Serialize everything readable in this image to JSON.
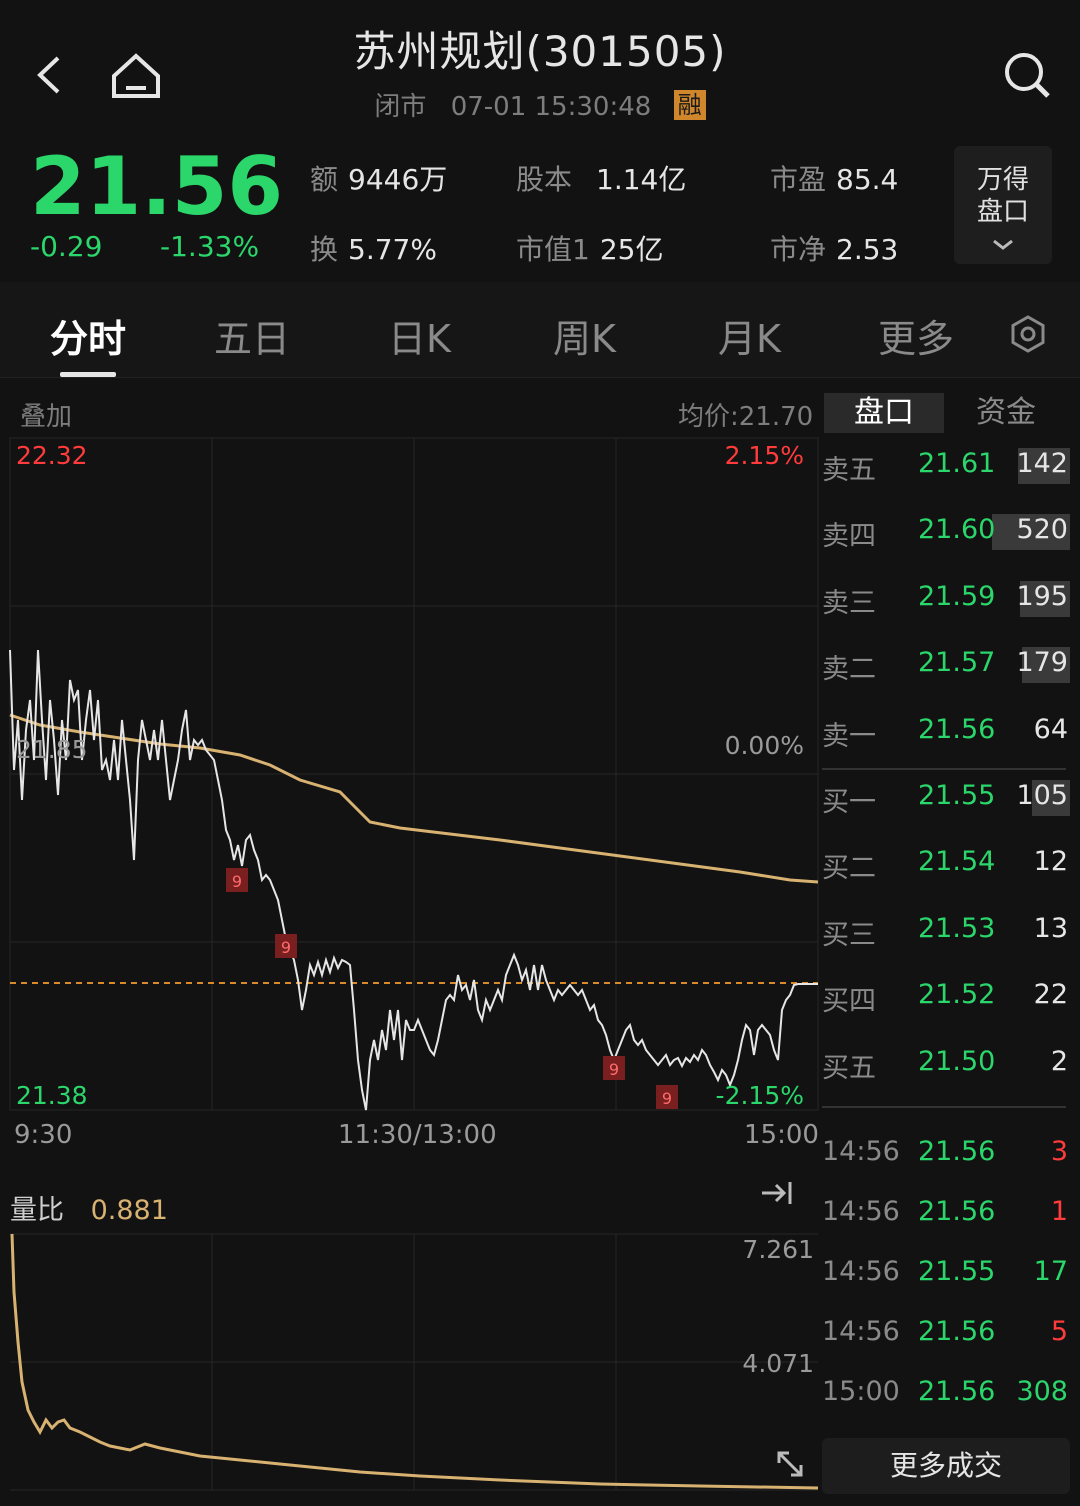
{
  "header": {
    "title": "苏州规划(301505)",
    "status": "闭市",
    "datetime": "07-01 15:30:48",
    "margin_badge": "融"
  },
  "quote": {
    "price": "21.56",
    "change": "-0.29",
    "change_pct": "-1.33%",
    "stats": [
      {
        "label": "额",
        "value": "9446万"
      },
      {
        "label": "股本",
        "value": "1.14亿"
      },
      {
        "label": "市盈",
        "value": "85.4"
      },
      {
        "label": "换",
        "value": "5.77%"
      },
      {
        "label": "市值1",
        "value": "25亿"
      },
      {
        "label": "市净",
        "value": "2.53"
      }
    ],
    "wande_label_1": "万得",
    "wande_label_2": "盘口"
  },
  "tabs": [
    "分时",
    "五日",
    "日K",
    "周K",
    "月K",
    "更多"
  ],
  "chart": {
    "overlay_label": "叠加",
    "avg_price_label": "均价:21.70",
    "y_high": "22.32",
    "y_high_pct": "2.15%",
    "y_mid": "21.85",
    "y_mid_pct": "0.00%",
    "y_low": "21.38",
    "y_low_pct": "-2.15%",
    "x_start": "9:30",
    "x_mid": "11:30/13:00",
    "x_end": "15:00",
    "marker_label": "9",
    "colors": {
      "price_line": "#e6e6e6",
      "avg_line": "#d8b271",
      "up": "#ff3b3b",
      "down": "#2bd66b"
    }
  },
  "volume_ratio": {
    "label": "量比",
    "value": "0.881",
    "y_top": "7.261",
    "y_mid": "4.071"
  },
  "panel_tabs": {
    "order_book": "盘口",
    "capital": "资金"
  },
  "order_book": [
    {
      "name": "卖五",
      "price": "21.61",
      "vol": "142"
    },
    {
      "name": "卖四",
      "price": "21.60",
      "vol": "520"
    },
    {
      "name": "卖三",
      "price": "21.59",
      "vol": "195"
    },
    {
      "name": "卖二",
      "price": "21.57",
      "vol": "179"
    },
    {
      "name": "卖一",
      "price": "21.56",
      "vol": "64"
    },
    {
      "name": "买一",
      "price": "21.55",
      "vol": "105"
    },
    {
      "name": "买二",
      "price": "21.54",
      "vol": "12"
    },
    {
      "name": "买三",
      "price": "21.53",
      "vol": "13"
    },
    {
      "name": "买四",
      "price": "21.52",
      "vol": "22"
    },
    {
      "name": "买五",
      "price": "21.50",
      "vol": "2"
    }
  ],
  "trades": [
    {
      "time": "14:56",
      "price": "21.56",
      "vol": "3",
      "side": "up"
    },
    {
      "time": "14:56",
      "price": "21.56",
      "vol": "1",
      "side": "up"
    },
    {
      "time": "14:56",
      "price": "21.55",
      "vol": "17",
      "side": "down"
    },
    {
      "time": "14:56",
      "price": "21.56",
      "vol": "5",
      "side": "up"
    },
    {
      "time": "15:00",
      "price": "21.56",
      "vol": "308",
      "side": "down"
    }
  ],
  "more_trades_label": "更多成交"
}
